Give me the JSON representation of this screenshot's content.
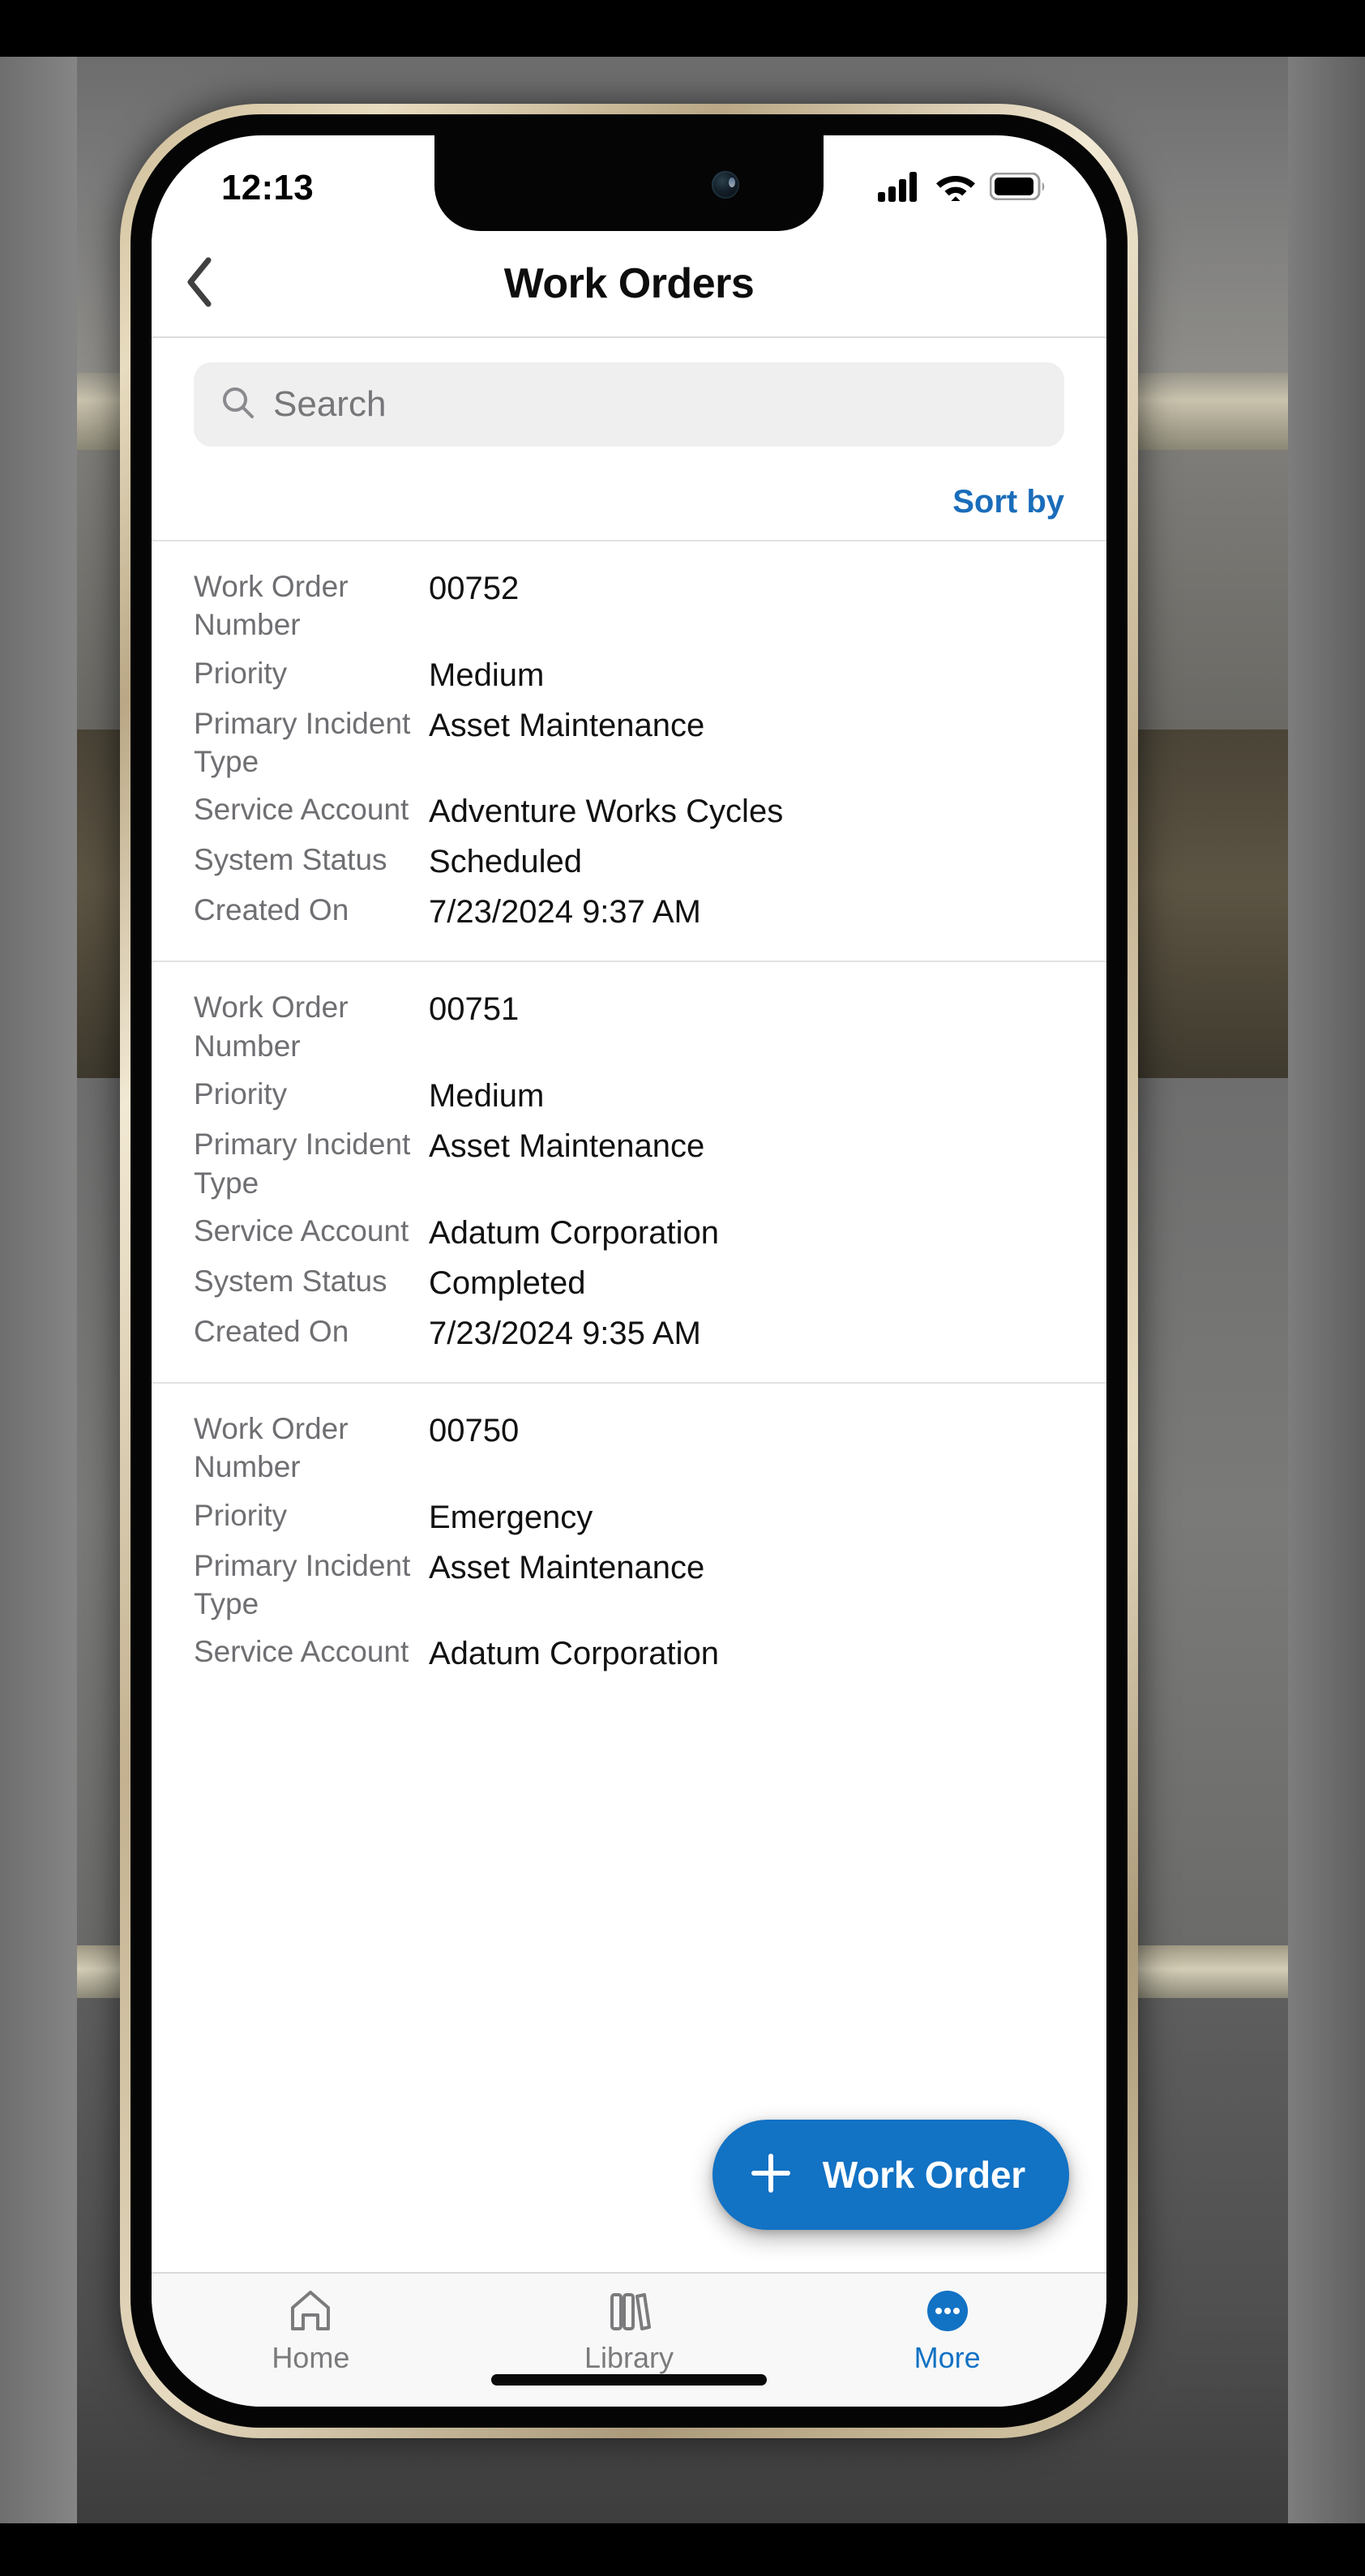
{
  "status_bar": {
    "time": "12:13",
    "icons": [
      "cellular-signal-icon",
      "wifi-icon",
      "battery-icon"
    ]
  },
  "nav": {
    "back_icon": "chevron-left-icon",
    "title": "Work Orders"
  },
  "search": {
    "icon": "search-icon",
    "placeholder": "Search",
    "value": ""
  },
  "list_toolbar": {
    "sort_label": "Sort by"
  },
  "field_labels": {
    "work_order_number": "Work Order Number",
    "priority": "Priority",
    "primary_incident_type": "Primary Incident Type",
    "service_account": "Service Account",
    "system_status": "System Status",
    "created_on": "Created On"
  },
  "records": [
    {
      "work_order_number": "00752",
      "priority": "Medium",
      "primary_incident_type": "Asset Maintenance",
      "service_account": "Adventure Works Cycles",
      "system_status": "Scheduled",
      "created_on": "7/23/2024 9:37 AM"
    },
    {
      "work_order_number": "00751",
      "priority": "Medium",
      "primary_incident_type": "Asset Maintenance",
      "service_account": "Adatum Corporation",
      "system_status": "Completed",
      "created_on": "7/23/2024 9:35 AM"
    },
    {
      "work_order_number": "00750",
      "priority": "Emergency",
      "primary_incident_type": "Asset Maintenance",
      "service_account": "Adatum Corporation",
      "system_status": "",
      "created_on": ""
    }
  ],
  "fab": {
    "icon": "plus-icon",
    "label": "Work Order",
    "color": "#1272c4"
  },
  "tabs": [
    {
      "label": "Home",
      "icon": "home-icon",
      "active": false
    },
    {
      "label": "Library",
      "icon": "library-icon",
      "active": false
    },
    {
      "label": "More",
      "icon": "more-ellipsis-icon",
      "active": true
    }
  ],
  "colors": {
    "accent": "#1272c4",
    "link": "#1a6dba",
    "label_gray": "#6f6f73",
    "value_black": "#111111"
  }
}
